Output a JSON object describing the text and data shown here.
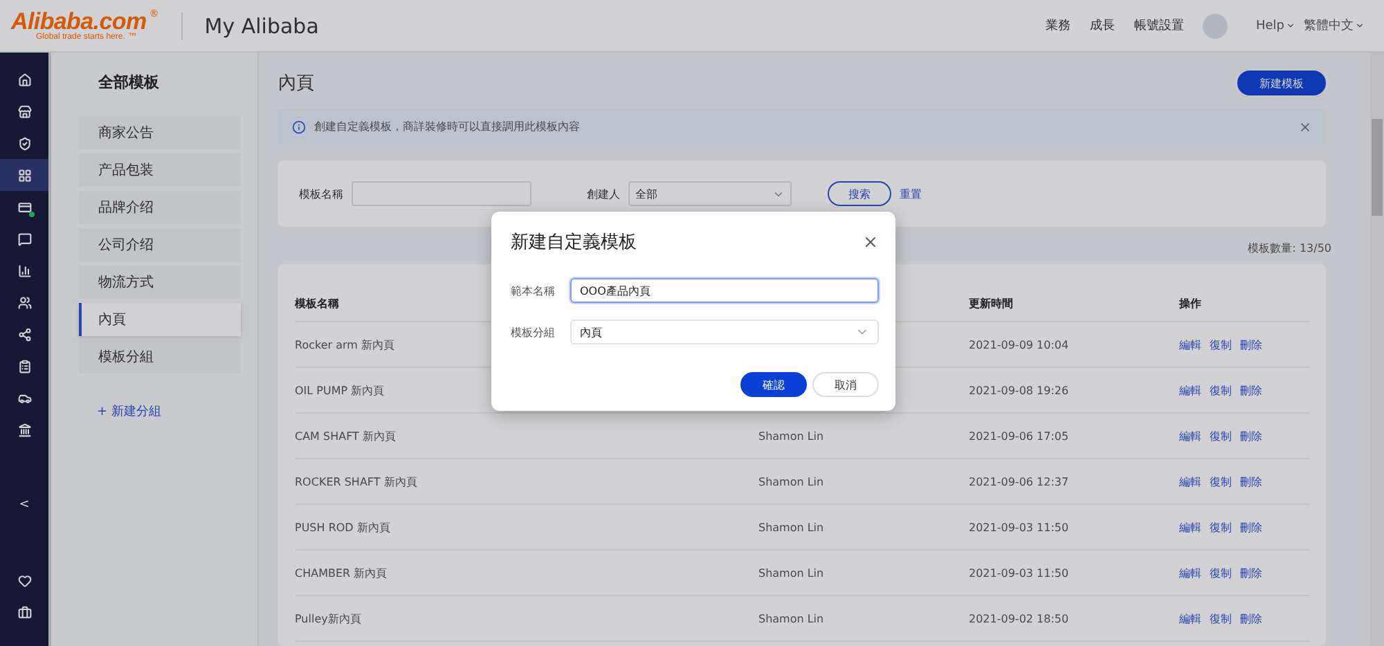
{
  "header": {
    "logo": "Alibaba.com",
    "logo_mark": "®",
    "tagline": "Global trade starts here.",
    "tagline_mark": "™",
    "title": "My Alibaba",
    "nav": [
      "業務",
      "成長",
      "帳號設置"
    ],
    "help": "Help",
    "language": "繁體中文"
  },
  "rail": {
    "items": [
      {
        "selected": false,
        "badge": false
      },
      {
        "selected": false,
        "badge": false
      },
      {
        "selected": false,
        "badge": false
      },
      {
        "selected": true,
        "badge": false
      },
      {
        "selected": false,
        "badge": true
      },
      {
        "selected": false,
        "badge": false
      },
      {
        "selected": false,
        "badge": false
      },
      {
        "selected": false,
        "badge": false
      },
      {
        "selected": false,
        "badge": false
      },
      {
        "selected": false,
        "badge": false
      },
      {
        "selected": false,
        "badge": false
      },
      {
        "selected": false,
        "badge": false
      }
    ],
    "collapse": "<"
  },
  "sidebar": {
    "title": "全部模板",
    "items": [
      {
        "label": "商家公告",
        "selected": false
      },
      {
        "label": "产品包装",
        "selected": false
      },
      {
        "label": "品牌介绍",
        "selected": false
      },
      {
        "label": "公司介绍",
        "selected": false
      },
      {
        "label": "物流方式",
        "selected": false
      },
      {
        "label": "內頁",
        "selected": true
      },
      {
        "label": "模板分組",
        "selected": false
      }
    ],
    "add_group": "+ 新建分組"
  },
  "main": {
    "title": "內頁",
    "new_button": "新建模板",
    "notice": "創建自定義模板，商詳裝修時可以直接調用此模板內容",
    "filters": {
      "name_label": "模板名稱",
      "creator_label": "創建人",
      "creator_value": "全部",
      "search": "搜索",
      "reset": "重置"
    },
    "count": "模板數量: 13/50",
    "table": {
      "columns": [
        "模板名稱",
        null,
        "更新時間",
        "操作"
      ],
      "rows": [
        {
          "name": "Rocker arm 新內頁",
          "updated": "2021-09-09 10:04",
          "actions": [
            "編輯",
            "復制",
            "刪除"
          ]
        },
        {
          "name": "OIL PUMP 新內頁",
          "updated": "2021-09-08 19:26",
          "actions": [
            "編輯",
            "復制",
            "刪除"
          ]
        },
        {
          "name": "CAM SHAFT 新內頁",
          "creator": "Shamon Lin",
          "updated": "2021-09-06 17:05",
          "actions": [
            "編輯",
            "復制",
            "刪除"
          ]
        },
        {
          "name": "ROCKER SHAFT 新內頁",
          "creator": "Shamon Lin",
          "updated": "2021-09-06 12:37",
          "actions": [
            "編輯",
            "復制",
            "刪除"
          ]
        },
        {
          "name": "PUSH ROD 新內頁",
          "creator": "Shamon Lin",
          "updated": "2021-09-03 11:50",
          "actions": [
            "編輯",
            "復制",
            "刪除"
          ]
        },
        {
          "name": "CHAMBER 新內頁",
          "creator": "Shamon Lin",
          "updated": "2021-09-03 11:50",
          "actions": [
            "編輯",
            "復制",
            "刪除"
          ]
        },
        {
          "name": "Pulley新內頁",
          "creator": "Shamon Lin",
          "updated": "2021-09-02 18:50",
          "actions": [
            "編輯",
            "復制",
            "刪除"
          ]
        }
      ]
    }
  },
  "dialog": {
    "title": "新建自定義模板",
    "fields": [
      {
        "kind": "input",
        "label": "範本名稱",
        "value": "OOO產品內頁",
        "focused": true
      },
      {
        "kind": "select",
        "label": "模板分組",
        "value": "內頁",
        "focused": false
      }
    ],
    "ok": "確認",
    "cancel": "取消"
  }
}
